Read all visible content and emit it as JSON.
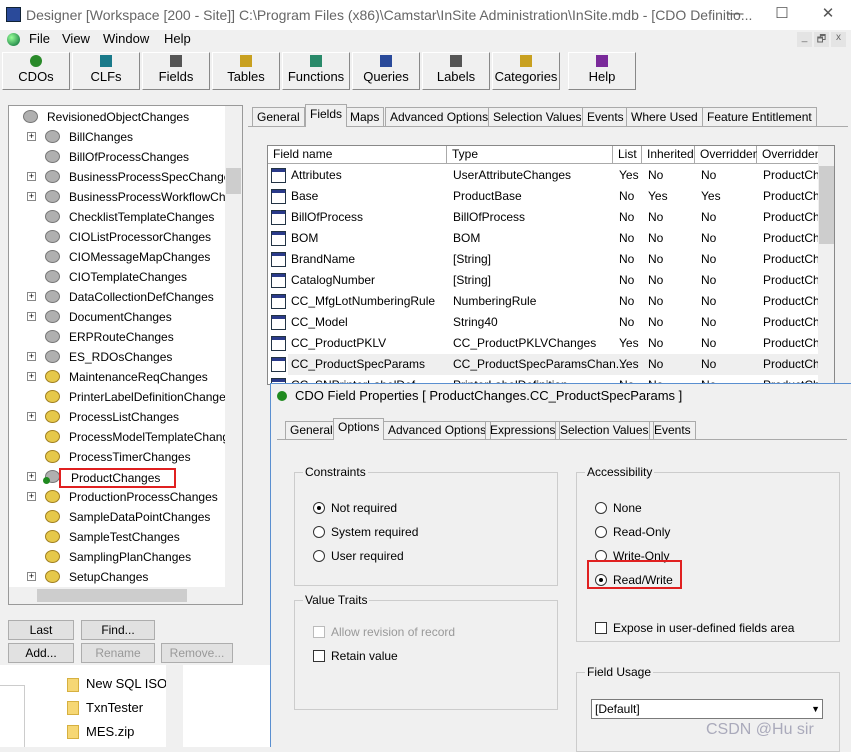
{
  "window": {
    "title": "Designer [Workspace [200 - Site]]  C:\\Program Files (x86)\\Camstar\\InSite Administration\\InSite.mdb - [CDO Definitio...",
    "minimize": "—",
    "maximize": "☐",
    "close": "✕"
  },
  "menu": [
    "File",
    "View",
    "Window",
    "Help"
  ],
  "mdi": [
    "_",
    "🗗",
    "x"
  ],
  "toolbar": [
    {
      "label": "CDOs",
      "icon": "cdo-icon"
    },
    {
      "label": "CLFs",
      "icon": "clf-icon"
    },
    {
      "label": "Fields",
      "icon": "fields-icon"
    },
    {
      "label": "Tables",
      "icon": "tables-icon"
    },
    {
      "label": "Functions",
      "icon": "functions-icon"
    },
    {
      "label": "Queries",
      "icon": "queries-icon"
    },
    {
      "label": "Labels",
      "icon": "labels-icon"
    },
    {
      "label": "Categories",
      "icon": "categories-icon"
    },
    {
      "label": "Help",
      "icon": "help-book-icon"
    }
  ],
  "tree": {
    "root": "RevisionedObjectChanges",
    "items": [
      {
        "label": "BillChanges",
        "exp": true,
        "y": false
      },
      {
        "label": "BillOfProcessChanges",
        "exp": false,
        "y": false
      },
      {
        "label": "BusinessProcessSpecChanges",
        "exp": true,
        "y": false
      },
      {
        "label": "BusinessProcessWorkflowChang",
        "exp": true,
        "y": false
      },
      {
        "label": "ChecklistTemplateChanges",
        "exp": false,
        "y": false
      },
      {
        "label": "CIOListProcessorChanges",
        "exp": false,
        "y": false
      },
      {
        "label": "CIOMessageMapChanges",
        "exp": false,
        "y": false
      },
      {
        "label": "CIOTemplateChanges",
        "exp": false,
        "y": false
      },
      {
        "label": "DataCollectionDefChanges",
        "exp": true,
        "y": false
      },
      {
        "label": "DocumentChanges",
        "exp": true,
        "y": false
      },
      {
        "label": "ERPRouteChanges",
        "exp": false,
        "y": false
      },
      {
        "label": "ES_RDOsChanges",
        "exp": true,
        "y": false
      },
      {
        "label": "MaintenanceReqChanges",
        "exp": true,
        "y": true
      },
      {
        "label": "PrinterLabelDefinitionChanges",
        "exp": false,
        "y": true
      },
      {
        "label": "ProcessListChanges",
        "exp": true,
        "y": true
      },
      {
        "label": "ProcessModelTemplateChanges",
        "exp": false,
        "y": true
      },
      {
        "label": "ProcessTimerChanges",
        "exp": false,
        "y": true
      },
      {
        "label": "ProductChanges",
        "exp": true,
        "y": false,
        "sel": true
      },
      {
        "label": "ProductionProcessChanges",
        "exp": true,
        "y": true
      },
      {
        "label": "SampleDataPointChanges",
        "exp": false,
        "y": true
      },
      {
        "label": "SampleTestChanges",
        "exp": false,
        "y": true
      },
      {
        "label": "SamplingPlanChanges",
        "exp": false,
        "y": true
      },
      {
        "label": "SetupChanges",
        "exp": true,
        "y": true
      }
    ]
  },
  "tree_buttons": {
    "last": "Last",
    "find": "Find...",
    "add": "Add...",
    "rename": "Rename",
    "remove": "Remove..."
  },
  "tabs": [
    "General",
    "Fields",
    "Maps",
    "Advanced Options",
    "Selection Values",
    "Events",
    "Where Used",
    "Feature Entitlement"
  ],
  "active_tab": "Fields",
  "grid": {
    "columns": [
      "Field name",
      "Type",
      "List",
      "Inherited",
      "Overridden",
      "Overridden"
    ],
    "rows": [
      [
        "Attributes",
        "UserAttributeChanges",
        "Yes",
        "No",
        "No",
        "ProductCh"
      ],
      [
        "Base",
        "ProductBase",
        "No",
        "Yes",
        "Yes",
        "ProductCh"
      ],
      [
        "BillOfProcess",
        "BillOfProcess",
        "No",
        "No",
        "No",
        "ProductCh"
      ],
      [
        "BOM",
        "BOM",
        "No",
        "No",
        "No",
        "ProductCh"
      ],
      [
        "BrandName",
        "[String]",
        "No",
        "No",
        "No",
        "ProductCh"
      ],
      [
        "CatalogNumber",
        "[String]",
        "No",
        "No",
        "No",
        "ProductCh"
      ],
      [
        "CC_MfgLotNumberingRule",
        "NumberingRule",
        "No",
        "No",
        "No",
        "ProductCh"
      ],
      [
        "CC_Model",
        "String40",
        "No",
        "No",
        "No",
        "ProductCh"
      ],
      [
        "CC_ProductPKLV",
        "CC_ProductPKLVChanges",
        "Yes",
        "No",
        "No",
        "ProductCh"
      ],
      [
        "CC_ProductSpecParams",
        "CC_ProductSpecParamsChan...",
        "Yes",
        "No",
        "No",
        "ProductCh"
      ],
      [
        "CC_SNPrinterLabelDef",
        "PrinterLabelDefinition",
        "No",
        "No",
        "No",
        "ProductCh"
      ]
    ],
    "string_rows": [
      4,
      5,
      7
    ],
    "selected_row": 9
  },
  "dialog": {
    "title": "CDO Field Properties [ ProductChanges.CC_ProductSpecParams ]",
    "tabs": [
      "General",
      "Options",
      "Advanced Options",
      "Expressions",
      "Selection Values",
      "Events"
    ],
    "active_tab": "Options",
    "constraints": {
      "label": "Constraints",
      "options": [
        "Not required",
        "System required",
        "User required"
      ],
      "selected": 0
    },
    "value_traits": {
      "label": "Value Traits",
      "options": [
        "Allow revision of record",
        "Retain value"
      ]
    },
    "accessibility": {
      "label": "Accessibility",
      "options": [
        "None",
        "Read-Only",
        "Write-Only",
        "Read/Write"
      ],
      "selected": 3,
      "expose": "Expose in user-defined fields area"
    },
    "field_usage": {
      "label": "Field Usage",
      "value": "[Default]"
    }
  },
  "explorer": [
    "New SQL ISO",
    "TxnTester",
    "MES.zip"
  ],
  "watermark": "CSDN @Hu  sir",
  "colors": {
    "highlight": "#e02020",
    "dialog_border": "#5a8fd0"
  }
}
